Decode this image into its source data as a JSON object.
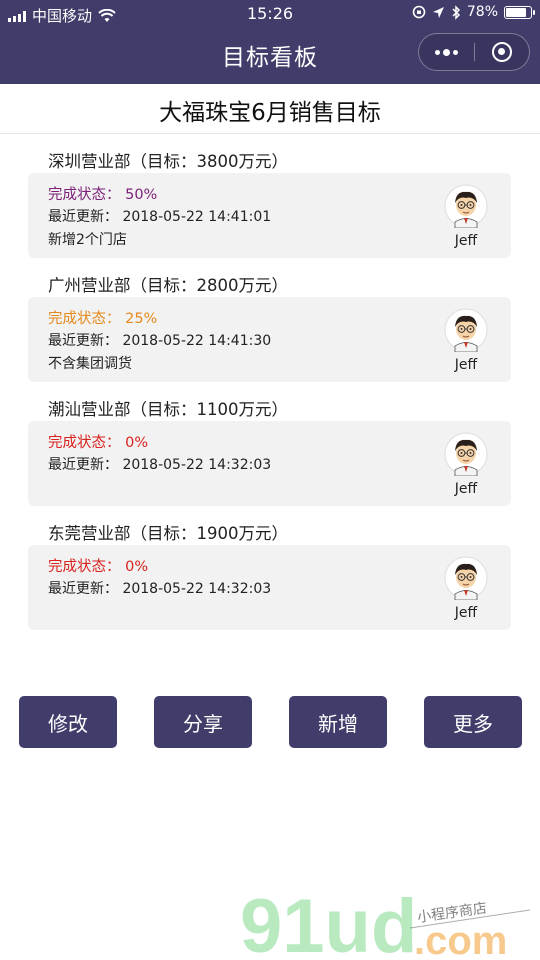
{
  "status_bar": {
    "carrier": "中国移动",
    "time": "15:26",
    "battery": "78%"
  },
  "nav": {
    "title": "目标看板"
  },
  "page": {
    "title": "大福珠宝6月销售目标"
  },
  "departments": [
    {
      "header": "深圳营业部（目标：3800万元）",
      "status_label": "完成状态：",
      "status_value": "50%",
      "update_label": "最近更新：",
      "update_time": "2018-05-22 14:41:01",
      "note": "新增2个门店",
      "owner": "Jeff",
      "status_color": "#7b1f78"
    },
    {
      "header": "广州营业部（目标：2800万元）",
      "status_label": "完成状态：",
      "status_value": "25%",
      "update_label": "最近更新：",
      "update_time": "2018-05-22 14:41:30",
      "note": "不含集团调货",
      "owner": "Jeff",
      "status_color": "#e58a1c"
    },
    {
      "header": "潮汕营业部（目标：1100万元）",
      "status_label": "完成状态：",
      "status_value": "0%",
      "update_label": "最近更新：",
      "update_time": "2018-05-22 14:32:03",
      "note": "",
      "owner": "Jeff",
      "status_color": "#d8231f"
    },
    {
      "header": "东莞营业部（目标：1900万元）",
      "status_label": "完成状态：",
      "status_value": "0%",
      "update_label": "最近更新：",
      "update_time": "2018-05-22 14:32:03",
      "note": "",
      "owner": "Jeff",
      "status_color": "#d8231f"
    }
  ],
  "actions": {
    "edit": "修改",
    "share": "分享",
    "add": "新增",
    "more": "更多"
  },
  "watermark": {
    "brand": "91ud",
    "domain": ".com",
    "tagline": "小程序商店"
  },
  "colors": {
    "header_bg": "#403d6b",
    "card_bg": "#f2f2f2"
  }
}
